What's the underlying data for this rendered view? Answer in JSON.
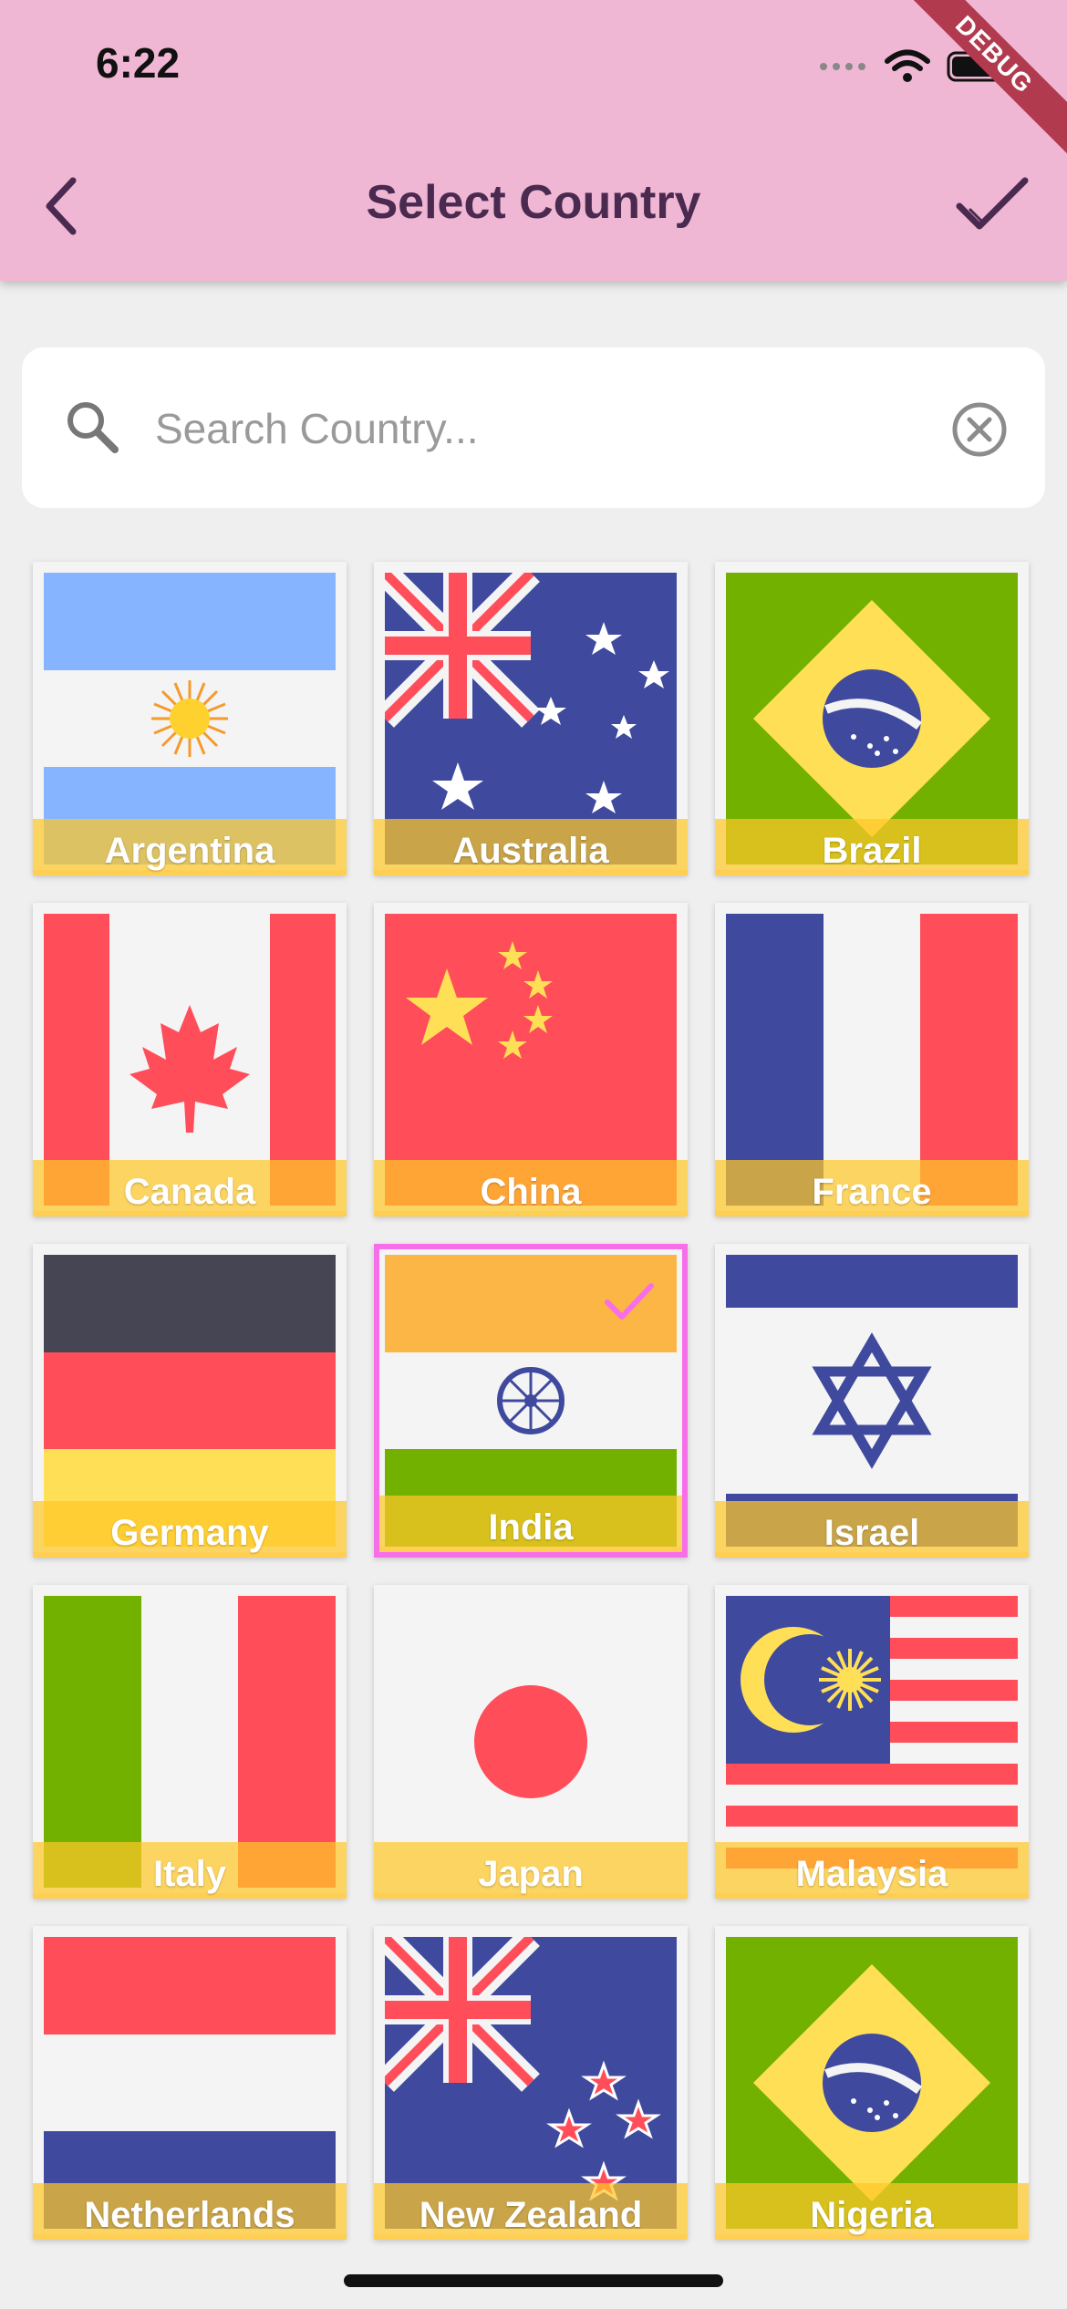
{
  "status_bar": {
    "time": "6:22",
    "debug": "DEBUG"
  },
  "app_bar": {
    "title": "Select Country",
    "back_icon": "chevron-left-icon",
    "confirm_icon": "check-icon"
  },
  "search": {
    "placeholder": "Search Country...",
    "value": "",
    "search_icon": "search-icon",
    "clear_icon": "clear-circle-icon"
  },
  "countries": [
    {
      "name": "Argentina",
      "selected": false
    },
    {
      "name": "Australia",
      "selected": false
    },
    {
      "name": "Brazil",
      "selected": false
    },
    {
      "name": "Canada",
      "selected": false
    },
    {
      "name": "China",
      "selected": false
    },
    {
      "name": "France",
      "selected": false
    },
    {
      "name": "Germany",
      "selected": false
    },
    {
      "name": "India",
      "selected": true
    },
    {
      "name": "Israel",
      "selected": false
    },
    {
      "name": "Italy",
      "selected": false
    },
    {
      "name": "Japan",
      "selected": false
    },
    {
      "name": "Malaysia",
      "selected": false
    },
    {
      "name": "Netherlands",
      "selected": false
    },
    {
      "name": "New Zealand",
      "selected": false
    },
    {
      "name": "Nigeria",
      "selected": false
    }
  ],
  "colors": {
    "app_bar": "#efb7d3",
    "title": "#4a2a50",
    "selected_border": "#f66ee8",
    "label_bar": "#ffcf54"
  }
}
